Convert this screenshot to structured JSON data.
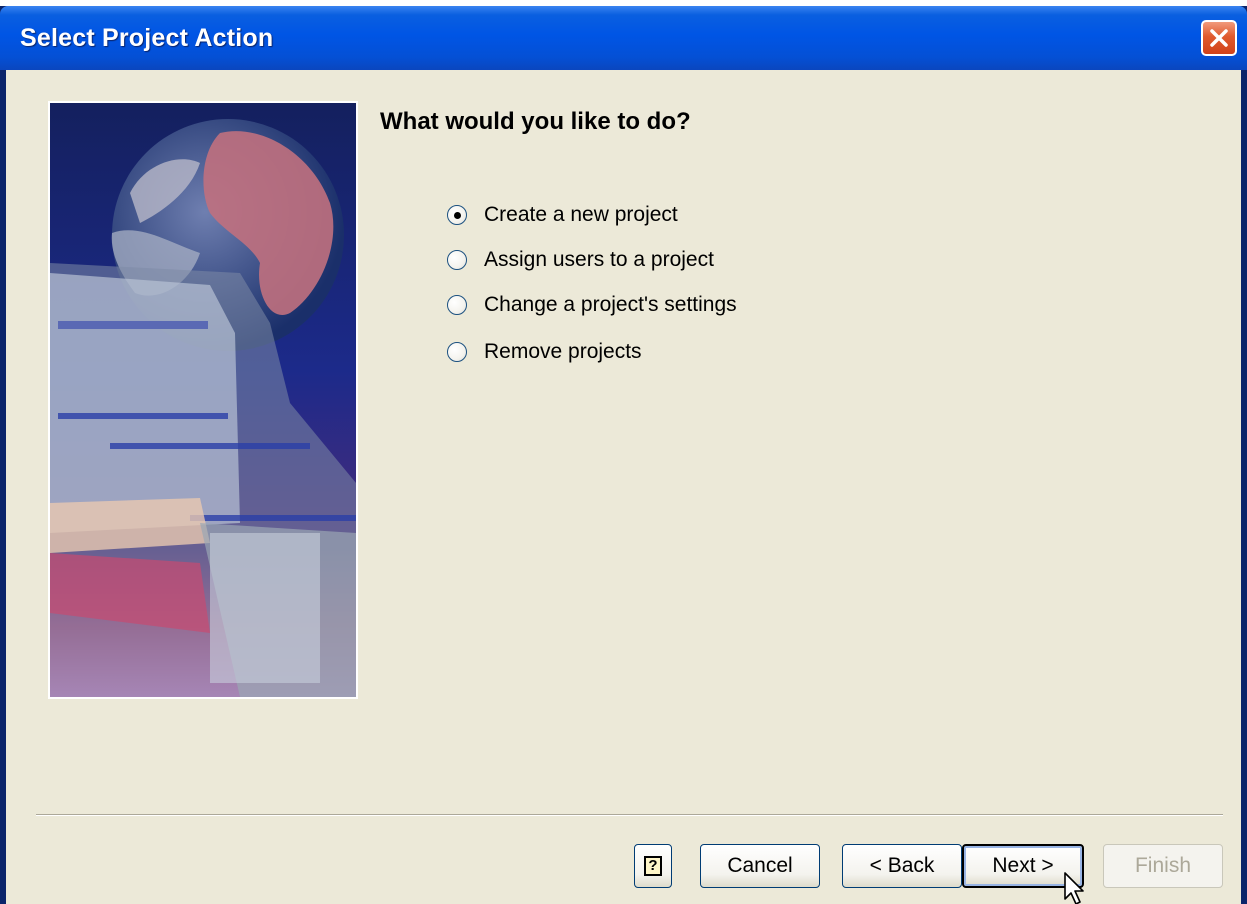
{
  "window": {
    "title": "Select Project Action"
  },
  "main": {
    "question": "What would you like to do?",
    "options": [
      {
        "label": "Create a new project",
        "checked": true
      },
      {
        "label": "Assign users to a project",
        "checked": false
      },
      {
        "label": "Change a project's settings",
        "checked": false
      },
      {
        "label": "Remove projects",
        "checked": false
      }
    ]
  },
  "buttons": {
    "help_label": "?",
    "cancel_label": "Cancel",
    "back_label": "< Back",
    "next_label": "Next >",
    "finish_label": "Finish"
  },
  "colors": {
    "titlebar": "#0055e5",
    "client_background": "#ece9d8",
    "close_button": "#e05a2e",
    "disabled_text": "#aca899"
  }
}
